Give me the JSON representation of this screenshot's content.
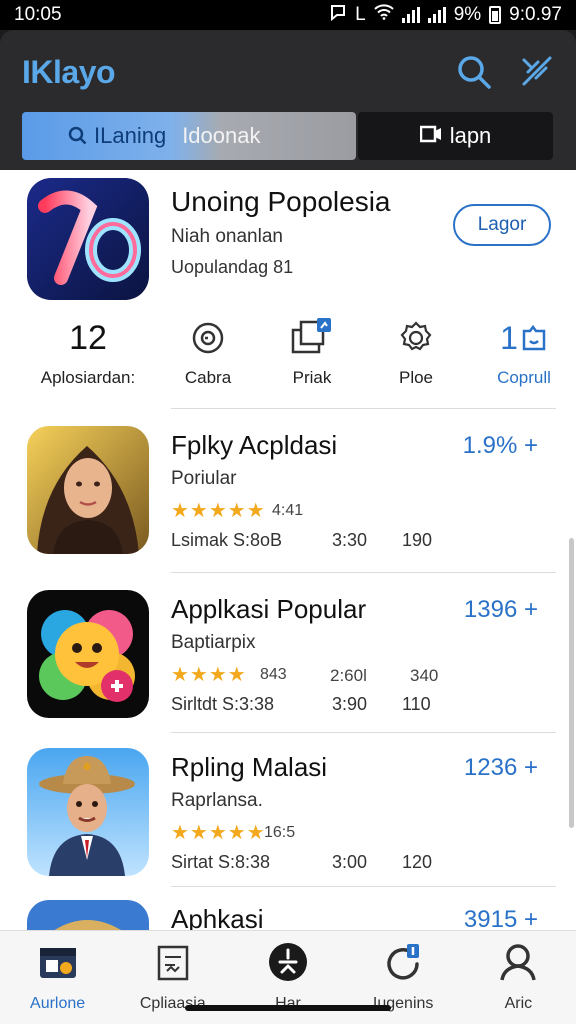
{
  "status": {
    "time": "10:05",
    "indicators": "L",
    "battery": "9%",
    "clock": "9:0.97"
  },
  "header": {
    "title": "IKlayo",
    "search_tab": "ILaning",
    "search_tab2": "Idoonak",
    "right_tab": "lapn"
  },
  "featured": {
    "title": "Unoing Popolesia",
    "subtitle": "Niah onanlan",
    "subtitle2": "Uopulandag 81",
    "button": "Lagor"
  },
  "stats": [
    {
      "value": "12",
      "label": "Aplosiardan:"
    },
    {
      "label": "Cabra",
      "icon": "clock-icon"
    },
    {
      "label": "Priak",
      "icon": "share-icon"
    },
    {
      "label": "Ploe",
      "icon": "settings-icon"
    },
    {
      "value": "1",
      "label": "Coprull",
      "icon": "chat-icon"
    }
  ],
  "apps": [
    {
      "name": "Fplky Acpldasi",
      "dev": "Poriular",
      "stars": "★★★★★",
      "rating": "4:41",
      "size": "Lsimak S:8oB",
      "time": "3:30",
      "downloads": "190",
      "pct": "1.9% +"
    },
    {
      "name": "Applkasi Popular",
      "dev": "Baptiarpix",
      "stars": "★★★★",
      "rating": "843",
      "rating_b": "2:60l",
      "rating_c": "340",
      "size": "Sirltdt S:3:38",
      "time": "3:90",
      "downloads": "110",
      "pct": "1396 +"
    },
    {
      "name": "Rpling Malasi",
      "dev": "Raprlansa.",
      "stars": "★★★★★",
      "rating": "16:5",
      "size": "Sirtat S:8:38",
      "time": "3:00",
      "downloads": "120",
      "pct": "1236 +"
    },
    {
      "name": "Aphkasi",
      "pct": "3915 +"
    }
  ],
  "nav": [
    {
      "label": "Aurlone",
      "icon": "apps-icon",
      "active": true
    },
    {
      "label": "Cpliaasia",
      "icon": "document-icon"
    },
    {
      "label": "Har",
      "icon": "compass-icon"
    },
    {
      "label": "Iugenins",
      "icon": "update-icon"
    },
    {
      "label": "Aric",
      "icon": "person-icon"
    }
  ],
  "colors": {
    "accent": "#2a72c8",
    "star": "#f2a91d",
    "header_bg": "#2b2b2e",
    "title": "#5aa8e8"
  }
}
